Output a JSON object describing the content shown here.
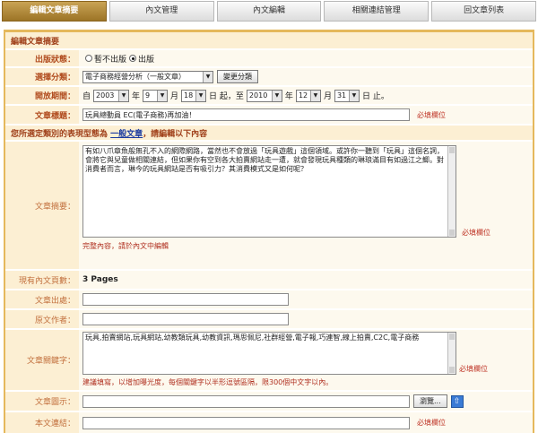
{
  "tabs": [
    "編輯文章摘要",
    "內文管理",
    "內文編輯",
    "相關連結管理",
    "回文章列表"
  ],
  "section_title": "編輯文章摘要",
  "publish": {
    "label": "出版狀態：",
    "options": [
      "暫不出版",
      "出版"
    ],
    "selected": "出版"
  },
  "category": {
    "label": "選擇分類：",
    "value": "電子商務經營分析（一般文章）",
    "button": "變更分類"
  },
  "period": {
    "label": "開放期間：",
    "prefix": "自",
    "start_year": "2003",
    "start_month": "9",
    "start_day": "18",
    "mid": "日 起，至",
    "end_year": "2010",
    "end_month": "12",
    "end_day": "31",
    "year": "年",
    "month": "月",
    "day": "日",
    "suffix": "日 止。"
  },
  "title": {
    "label": "文章標題：",
    "value": "玩具總動員 EC(電子商務)再加油！",
    "required": "必填欄位"
  },
  "notice": {
    "before": "您所選定類別的表現型態為",
    "link": "一般文章",
    "after": "，請編輯以下內容"
  },
  "summary": {
    "label": "文章摘要：",
    "text": "有如八爪章魚般無孔不入的網際網路，當然也不會放過「玩具遊戲」這個領域。或許你一聽到「玩具」這個名詞，會將它與兒童做相關連結，但如果你有空到各大拍賣網站走一遭，就會發現玩具種類的琳琅滿目有如過江之鯽。對消費者而言，琳今的玩具網站是否有吸引力？其消費模式又是如何呢？",
    "required": "必填欄位",
    "hint": "完整內容，請於內文中編輯"
  },
  "pages": {
    "label": "現有內文頁數：",
    "value": "3 Pages"
  },
  "source": {
    "label": "文章出處："
  },
  "author": {
    "label": "原文作者："
  },
  "keywords": {
    "label": "文章關鍵字：",
    "text": "玩具,拍賣網站,玩具網站,幼教類玩具,幼教資訊,瑪思佩尼,社群經營,電子報,巧連智,線上拍賣,C2C,電子商務",
    "required": "必填欄位",
    "hint": "建議填寫，以增加曝光度，每個關鍵字以半形逗號區隔，限300個中文字以內。"
  },
  "image": {
    "label": "文章圖示：",
    "browse": "瀏覽..."
  },
  "intro": {
    "label": "本文連結：",
    "required": "必填欄位"
  }
}
